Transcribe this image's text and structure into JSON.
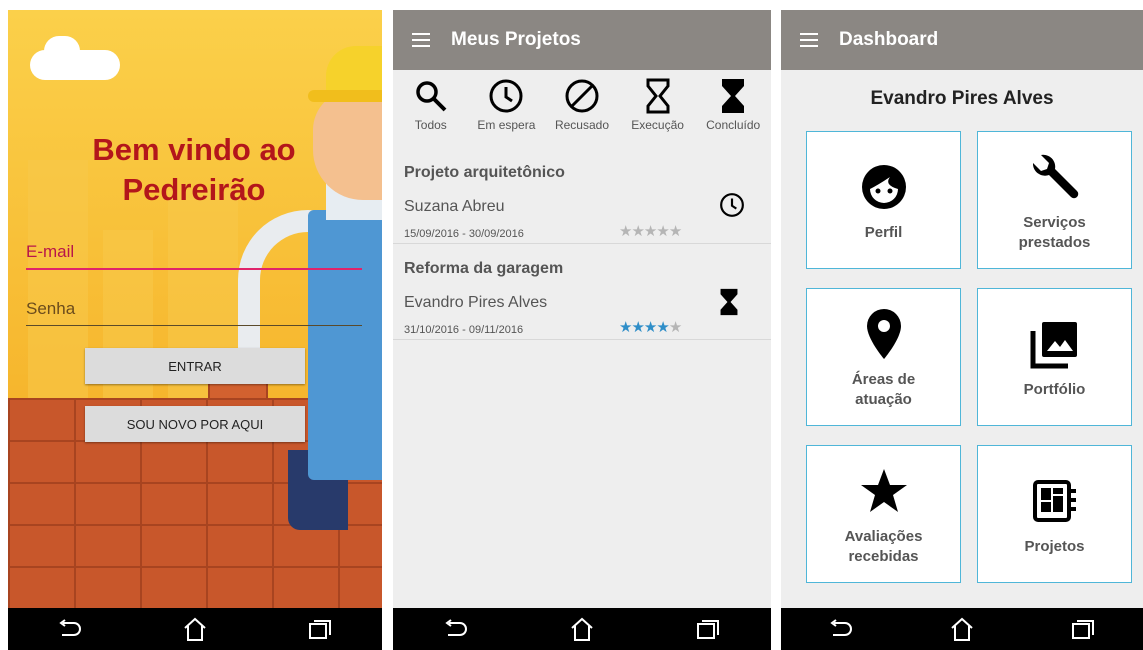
{
  "login": {
    "welcome_line1": "Bem vindo ao",
    "welcome_line2": "Pedreirão",
    "email_placeholder": "E-mail",
    "password_placeholder": "Senha",
    "enter_label": "ENTRAR",
    "new_user_label": "SOU NOVO POR AQUI"
  },
  "projects": {
    "title": "Meus Projetos",
    "filters": [
      {
        "label": "Todos",
        "icon": "search-icon"
      },
      {
        "label": "Em espera",
        "icon": "clock-icon"
      },
      {
        "label": "Recusado",
        "icon": "blocked-icon"
      },
      {
        "label": "Execução",
        "icon": "hourglass-outline-icon"
      },
      {
        "label": "Concluído",
        "icon": "hourglass-filled-icon"
      }
    ],
    "items": [
      {
        "title": "Projeto arquitetônico",
        "client": "Suzana Abreu",
        "dates": "15/09/2016 - 30/09/2016",
        "status_icon": "clock-icon",
        "rating": 0,
        "rating_max": 5
      },
      {
        "title": "Reforma da garagem",
        "client": "Evandro Pires Alves",
        "dates": "31/10/2016 - 09/11/2016",
        "status_icon": "hourglass-filled-icon",
        "rating": 4,
        "rating_max": 5
      }
    ]
  },
  "dashboard": {
    "title": "Dashboard",
    "user_name": "Evandro Pires Alves",
    "tiles": [
      {
        "label": "Perfil",
        "icon": "face-icon"
      },
      {
        "label": "Serviços prestados",
        "icon": "wrench-icon"
      },
      {
        "label": "Áreas de atuação",
        "icon": "location-pin-icon"
      },
      {
        "label": "Portfólio",
        "icon": "photo-library-icon"
      },
      {
        "label": "Avaliações recebidas",
        "icon": "star-icon"
      },
      {
        "label": "Projetos",
        "icon": "dashboard-board-icon"
      }
    ]
  },
  "colors": {
    "welcome_red": "#b3161b",
    "appbar_grey": "#8b8783",
    "tile_border": "#4fb6d8",
    "star_blue": "#2f8ec8",
    "email_underline": "#e0246a"
  }
}
